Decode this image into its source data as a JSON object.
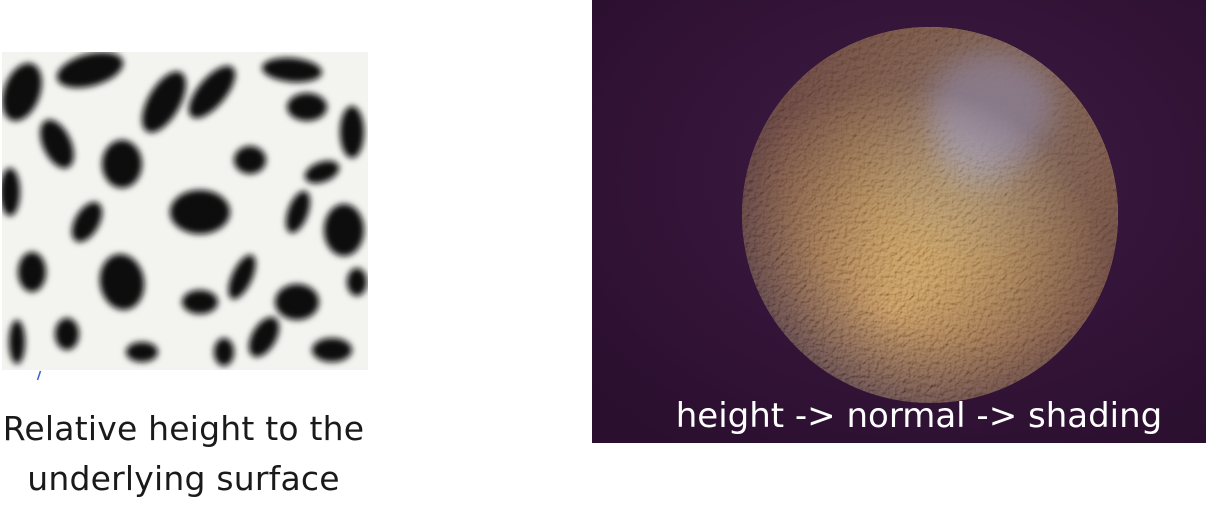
{
  "figure": {
    "left_panel": {
      "image_name": "height-map-image",
      "caption_line1": "Relative height to the",
      "caption_line2": "underlying surface"
    },
    "right_panel": {
      "image_name": "bump-mapped-orange",
      "caption": "height -> normal -> shading"
    }
  }
}
